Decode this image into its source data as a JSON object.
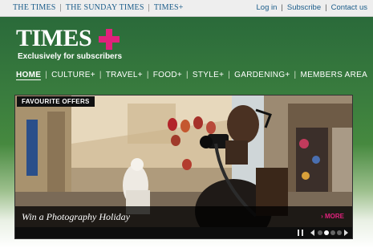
{
  "topbar": {
    "links_left": [
      "THE TIMES",
      "THE SUNDAY TIMES",
      "TIMES+"
    ],
    "links_right": [
      "Log in",
      "Subscribe",
      "Contact us"
    ],
    "separator": "|"
  },
  "logo": {
    "word": "TIMES",
    "tagline": "Exclusively for subscribers"
  },
  "nav": {
    "items": [
      "HOME",
      "CULTURE+",
      "TRAVEL+",
      "FOOD+",
      "STYLE+",
      "GARDENING+",
      "MEMBERS AREA"
    ],
    "separator": "|",
    "active": "HOME"
  },
  "feature": {
    "badge": "FAVOURITE OFFERS",
    "caption": "Win a Photography Holiday",
    "more": "› MORE",
    "slide_count": 4,
    "current_slide": 2
  },
  "colors": {
    "accent": "#e0227c",
    "link": "#1a5c8a",
    "green": "#2a6a3a"
  },
  "icons": [
    "pause-icon",
    "prev-arrow-icon",
    "next-arrow-icon"
  ]
}
